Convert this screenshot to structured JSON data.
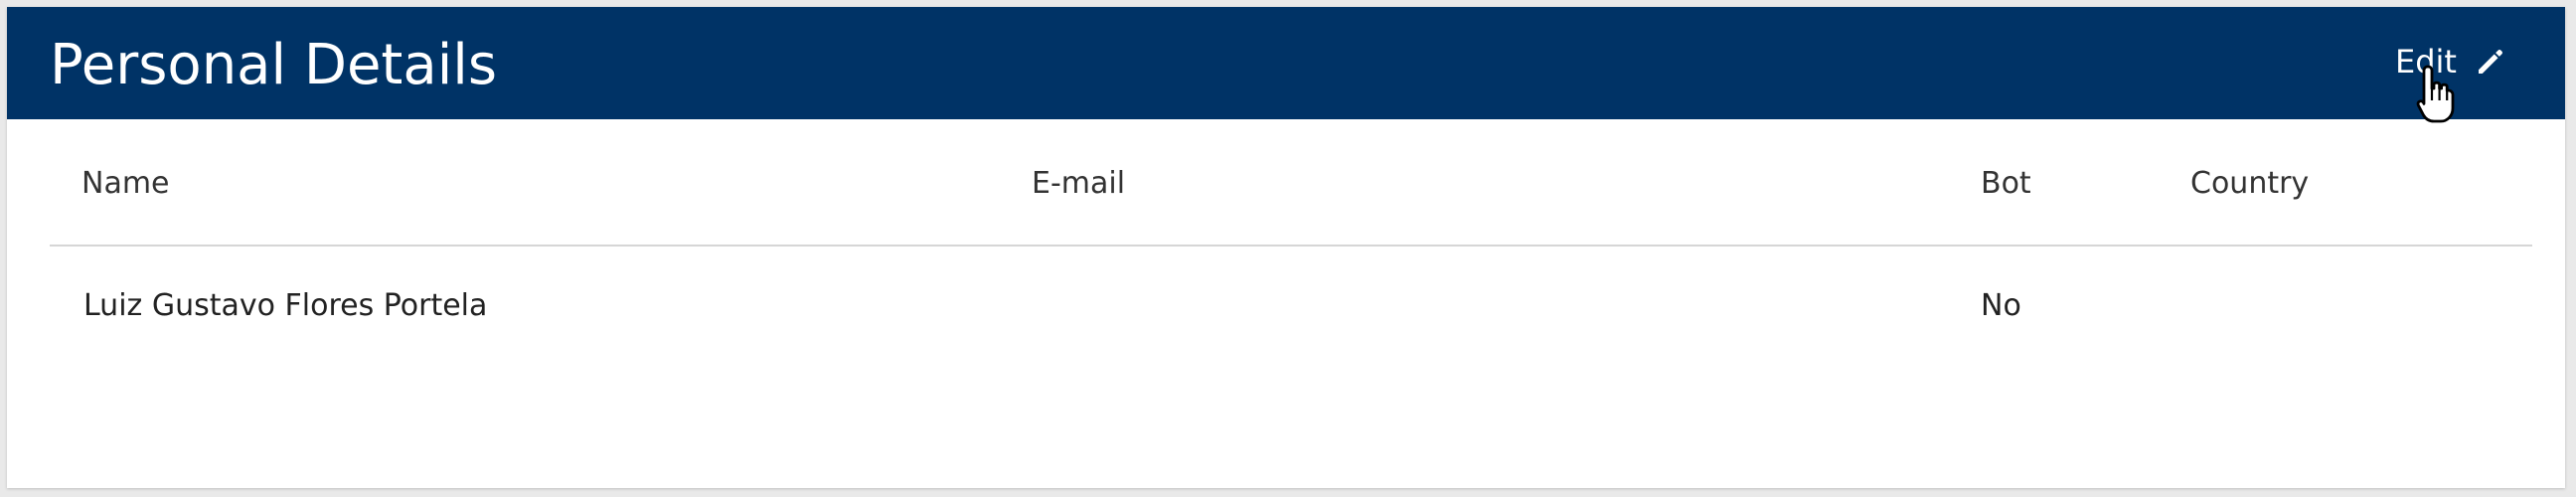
{
  "panel": {
    "title": "Personal Details",
    "edit_label": "Edit"
  },
  "table": {
    "headers": {
      "name": "Name",
      "email": "E-mail",
      "bot": "Bot",
      "country": "Country"
    },
    "rows": [
      {
        "name": "Luiz Gustavo Flores Portela",
        "email": "",
        "bot": "No",
        "country": ""
      }
    ]
  },
  "icons": {
    "edit": "pencil-icon",
    "cursor": "pointer-cursor-icon"
  },
  "colors": {
    "header_bg": "#003366",
    "header_text": "#ffffff"
  }
}
